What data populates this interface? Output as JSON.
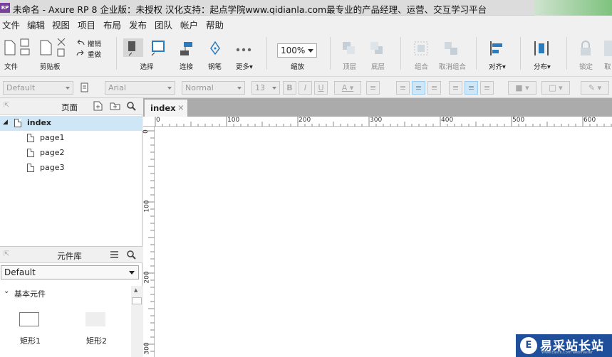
{
  "window": {
    "app_icon": "RP",
    "title": "未命名 - Axure RP 8 企业版：未授权 汉化支持：起点学院www.qidianla.com最专业的产品经理、运营、交互学习平台"
  },
  "menu": [
    "文件",
    "编辑",
    "视图",
    "项目",
    "布局",
    "发布",
    "团队",
    "帐户",
    "帮助"
  ],
  "toolbar": {
    "file": "文件",
    "clipboard": "剪贴板",
    "undo": "撤销",
    "redo": "重做",
    "select": "选择",
    "connect": "连接",
    "pen": "钢笔",
    "more": "更多▾",
    "zoom_value": "100%",
    "zoom": "缩放",
    "top": "顶层",
    "bottom": "底层",
    "group": "组合",
    "ungroup": "取消组合",
    "align": "对齐▾",
    "distribute": "分布▾",
    "lock": "锁定",
    "extra": "取"
  },
  "stylebar": {
    "style": "Default",
    "font": "Arial",
    "weight": "Normal",
    "size": "13",
    "bold": "B",
    "italic": "I",
    "underline": "U",
    "text_color": "A"
  },
  "pages_panel": {
    "title": "页面",
    "root": "index",
    "children": [
      "page1",
      "page2",
      "page3"
    ]
  },
  "widgets_panel": {
    "title": "元件库",
    "library": "Default",
    "category": "基本元件",
    "items": [
      "矩形1",
      "矩形2"
    ]
  },
  "canvas": {
    "tab": "index",
    "tab_close": "×",
    "ruler_top": [
      "0",
      "100",
      "200",
      "300",
      "400",
      "500",
      "600"
    ],
    "ruler_left": [
      "0",
      "100",
      "200",
      "300"
    ]
  },
  "watermark": {
    "badge": "E",
    "text": "易采站长站",
    "sub": "Www.Easck.Com Webmaster"
  },
  "colors": {
    "accent": "#cfe6f7",
    "app_icon": "#7b3fa0",
    "watermark": "#1f4f9a"
  }
}
